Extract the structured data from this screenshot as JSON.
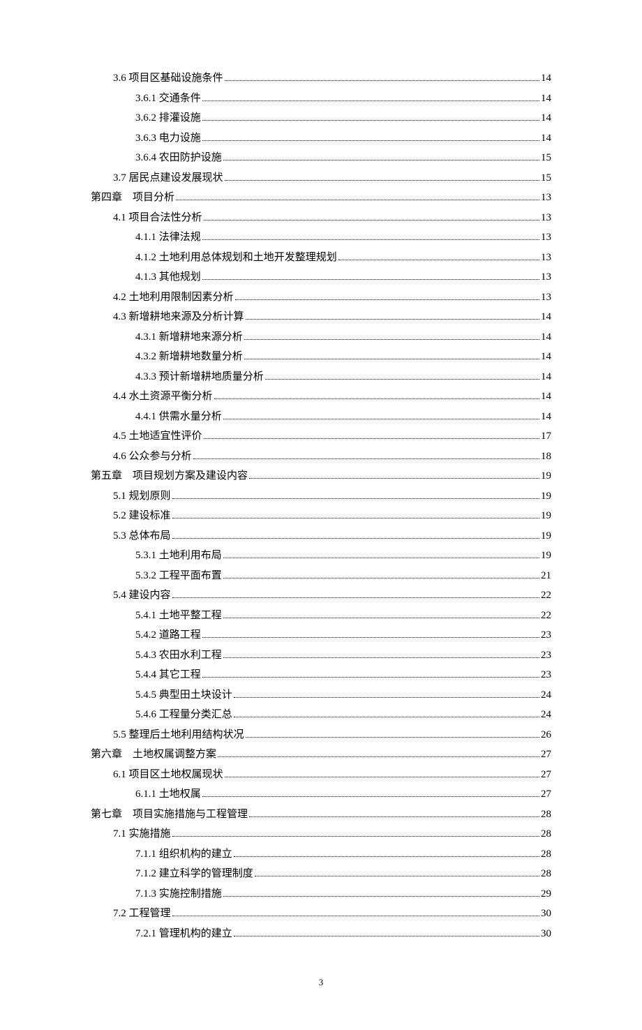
{
  "toc": [
    {
      "indent": 1,
      "title": "3.6 项目区基础设施条件",
      "page": "14"
    },
    {
      "indent": 2,
      "title": "3.6.1 交通条件",
      "page": "14"
    },
    {
      "indent": 2,
      "title": "3.6.2 排灌设施",
      "page": "14"
    },
    {
      "indent": 2,
      "title": "3.6.3 电力设施",
      "page": "14"
    },
    {
      "indent": 2,
      "title": "3.6.4 农田防护设施",
      "page": "15"
    },
    {
      "indent": 1,
      "title": "3.7 居民点建设发展现状",
      "page": "15"
    },
    {
      "indent": 0,
      "title": "第四章　项目分析",
      "page": "13"
    },
    {
      "indent": 1,
      "title": "4.1 项目合法性分析",
      "page": "13"
    },
    {
      "indent": 2,
      "title": "4.1.1 法律法规",
      "page": "13"
    },
    {
      "indent": 2,
      "title": "4.1.2 土地利用总体规划和土地开发整理规划",
      "page": "13"
    },
    {
      "indent": 2,
      "title": "4.1.3 其他规划",
      "page": "13"
    },
    {
      "indent": 1,
      "title": "4.2 土地利用限制因素分析",
      "page": "13"
    },
    {
      "indent": 1,
      "title": "4.3 新增耕地来源及分析计算",
      "page": "14"
    },
    {
      "indent": 2,
      "title": "4.3.1 新增耕地来源分析",
      "page": "14"
    },
    {
      "indent": 2,
      "title": "4.3.2 新增耕地数量分析",
      "page": "14"
    },
    {
      "indent": 2,
      "title": "4.3.3 预计新增耕地质量分析",
      "page": "14"
    },
    {
      "indent": 1,
      "title": "4.4 水土资源平衡分析",
      "page": "14"
    },
    {
      "indent": 2,
      "title": "4.4.1 供需水量分析",
      "page": "14"
    },
    {
      "indent": 1,
      "title": "4.5 土地适宜性评价",
      "page": "17"
    },
    {
      "indent": 1,
      "title": "4.6 公众参与分析",
      "page": "18"
    },
    {
      "indent": 0,
      "title": "第五章　项目规划方案及建设内容",
      "page": "19"
    },
    {
      "indent": 1,
      "title": "5.1 规划原则",
      "page": "19"
    },
    {
      "indent": 1,
      "title": "5.2 建设标准",
      "page": "19"
    },
    {
      "indent": 1,
      "title": "5.3 总体布局",
      "page": "19"
    },
    {
      "indent": 2,
      "title": "5.3.1 土地利用布局",
      "page": "19"
    },
    {
      "indent": 2,
      "title": "5.3.2 工程平面布置",
      "page": "21"
    },
    {
      "indent": 1,
      "title": "5.4 建设内容",
      "page": "22"
    },
    {
      "indent": 2,
      "title": "5.4.1 土地平整工程",
      "page": "22"
    },
    {
      "indent": 2,
      "title": "5.4.2 道路工程",
      "page": "23"
    },
    {
      "indent": 2,
      "title": "5.4.3 农田水利工程",
      "page": "23"
    },
    {
      "indent": 2,
      "title": "5.4.4 其它工程",
      "page": "23"
    },
    {
      "indent": 2,
      "title": "5.4.5  典型田土块设计",
      "page": "24"
    },
    {
      "indent": 2,
      "title": "5.4.6 工程量分类汇总",
      "page": "24"
    },
    {
      "indent": 1,
      "title": "5.5 整理后土地利用结构状况",
      "page": "26"
    },
    {
      "indent": 0,
      "title": "第六章　土地权属调整方案",
      "page": "27"
    },
    {
      "indent": 1,
      "title": "6.1 项目区土地权属现状",
      "page": "27"
    },
    {
      "indent": 2,
      "title": "6.1.1 土地权属",
      "page": "27"
    },
    {
      "indent": 0,
      "title": "第七章　项目实施措施与工程管理",
      "page": "28"
    },
    {
      "indent": 1,
      "title": "7.1 实施措施",
      "page": "28"
    },
    {
      "indent": 2,
      "title": "7.1.1 组织机构的建立",
      "page": "28"
    },
    {
      "indent": 2,
      "title": "7.1.2 建立科学的管理制度",
      "page": "28"
    },
    {
      "indent": 2,
      "title": "7.1.3 实施控制措施",
      "page": "29"
    },
    {
      "indent": 1,
      "title": "7.2 工程管理",
      "page": "30"
    },
    {
      "indent": 2,
      "title": "7.2.1 管理机构的建立",
      "page": "30"
    }
  ],
  "page_number": "3"
}
